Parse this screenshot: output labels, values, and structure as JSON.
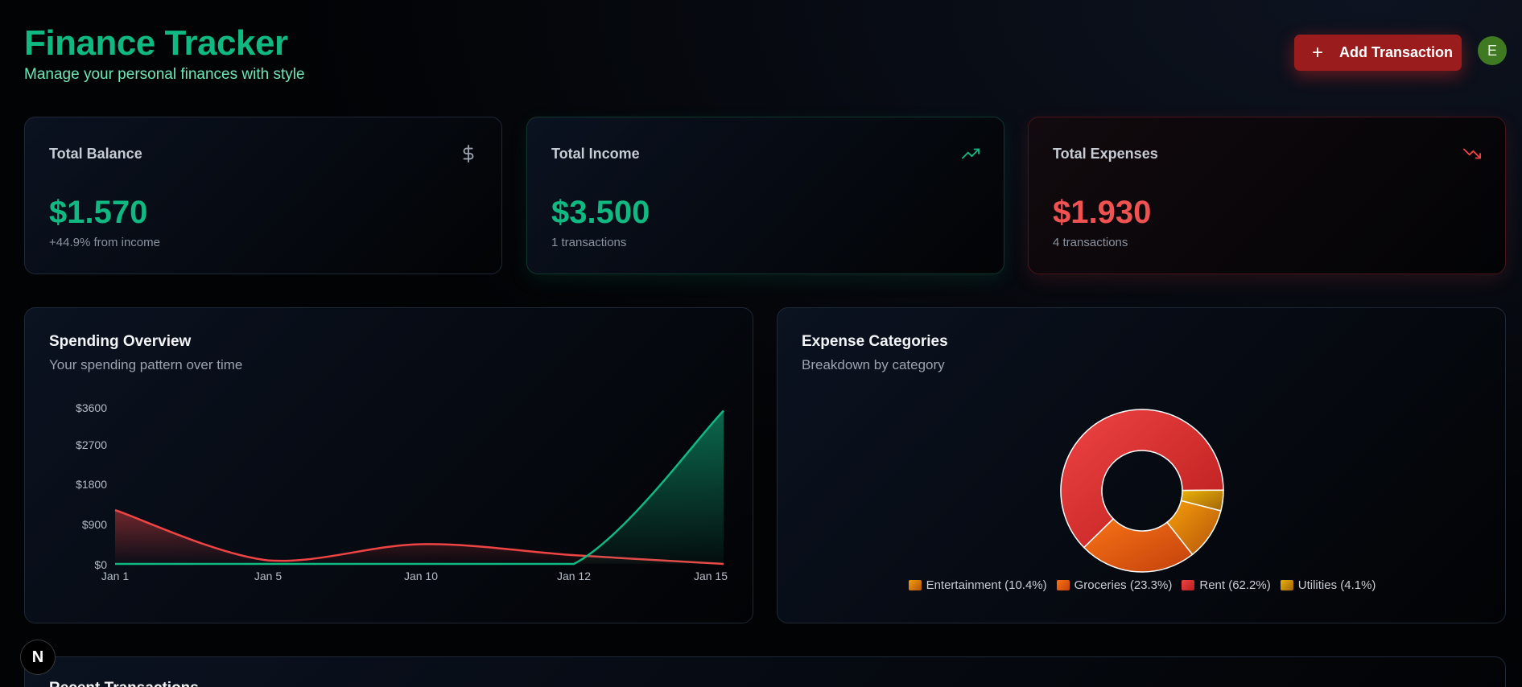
{
  "header": {
    "title": "Finance Tracker",
    "subtitle": "Manage your personal finances with style",
    "add_button_label": "Add Transaction",
    "avatar_initial": "E"
  },
  "stats": {
    "balance": {
      "label": "Total Balance",
      "value": "$1.570",
      "note": "+44.9% from income",
      "icon": "dollar-icon"
    },
    "income": {
      "label": "Total Income",
      "value": "$3.500",
      "note": "1 transactions",
      "icon": "trending-up-icon"
    },
    "expenses": {
      "label": "Total Expenses",
      "value": "$1.930",
      "note": "4 transactions",
      "icon": "trending-down-icon"
    }
  },
  "spending": {
    "title": "Spending Overview",
    "subtitle": "Your spending pattern over time"
  },
  "categories": {
    "title": "Expense Categories",
    "subtitle": "Breakdown by category"
  },
  "recent": {
    "title": "Recent Transactions"
  },
  "badge": {
    "label": "N"
  },
  "colors": {
    "accent_green": "#10b981",
    "expense_red": "#ef4444",
    "button_red": "#9b1c1c",
    "entertainment": "#d97706",
    "groceries": "#ea580c",
    "rent": "#dc2626",
    "utilities": "#ca8a04"
  },
  "chart_data": [
    {
      "type": "area",
      "x": [
        "Jan 1",
        "Jan 5",
        "Jan 10",
        "Jan 12",
        "Jan 15"
      ],
      "series": [
        {
          "values": [
            1230,
            80,
            450,
            200,
            0
          ],
          "color": "#ef4444"
        },
        {
          "values": [
            0,
            0,
            0,
            0,
            3500
          ],
          "color": "#10b981"
        }
      ],
      "yticks": [
        "$0",
        "$900",
        "$1800",
        "$2700",
        "$3600"
      ],
      "ylim": [
        0,
        3600
      ],
      "grid": false
    },
    {
      "type": "pie",
      "variant": "donut",
      "labels": [
        "Entertainment",
        "Groceries",
        "Rent",
        "Utilities"
      ],
      "legend_labels": [
        "Entertainment (10.4%)",
        "Groceries (23.3%)",
        "Rent (62.2%)",
        "Utilities (4.1%)"
      ],
      "values": [
        10.4,
        23.3,
        62.2,
        4.1
      ],
      "colors": [
        "#d97706",
        "#ea580c",
        "#dc2626",
        "#ca8a04"
      ],
      "legend_position": "bottom"
    }
  ]
}
